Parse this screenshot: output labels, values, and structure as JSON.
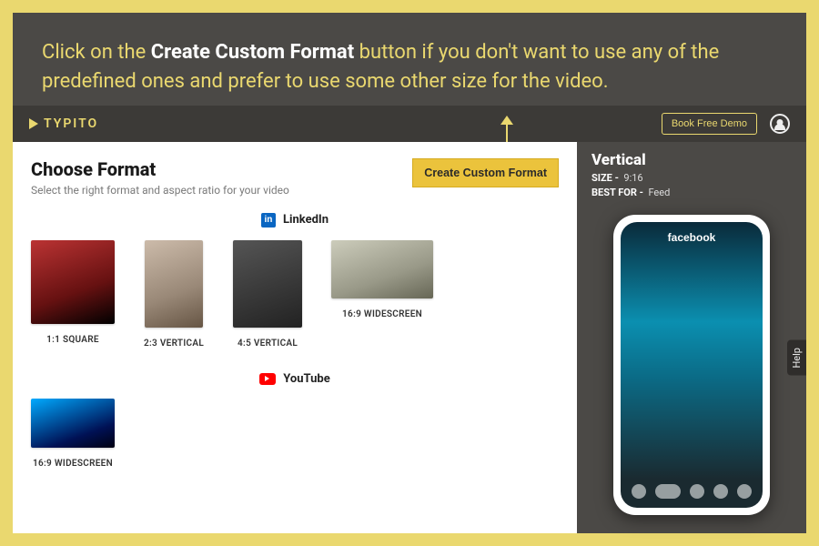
{
  "caption": {
    "pre": "Click on the ",
    "bold": "Create Custom Format",
    "post": " button if you don't want to use any of the predefined ones and prefer to use some other size for the video."
  },
  "brand": "TYPITO",
  "topbar": {
    "demo": "Book Free Demo"
  },
  "panel": {
    "title": "Choose Format",
    "subtitle": "Select the right format and aspect ratio for your video",
    "create_btn": "Create Custom Format",
    "linkedin_label": "LinkedIn",
    "youtube_label": "YouTube",
    "linkedin_formats": [
      {
        "key": "sq",
        "label": "1:1 SQUARE"
      },
      {
        "key": "v23",
        "label": "2:3 VERTICAL"
      },
      {
        "key": "v45",
        "label": "4:5 VERTICAL"
      },
      {
        "key": "w169",
        "label": "16:9 WIDESCREEN"
      }
    ],
    "youtube_formats": [
      {
        "key": "yt169",
        "label": "16:9 WIDESCREEN"
      }
    ]
  },
  "preview": {
    "title": "Vertical",
    "size_label": "SIZE -",
    "size_value": "9:16",
    "best_label": "BEST FOR -",
    "best_value": "Feed",
    "phone_app": "facebook"
  },
  "help": "Help"
}
